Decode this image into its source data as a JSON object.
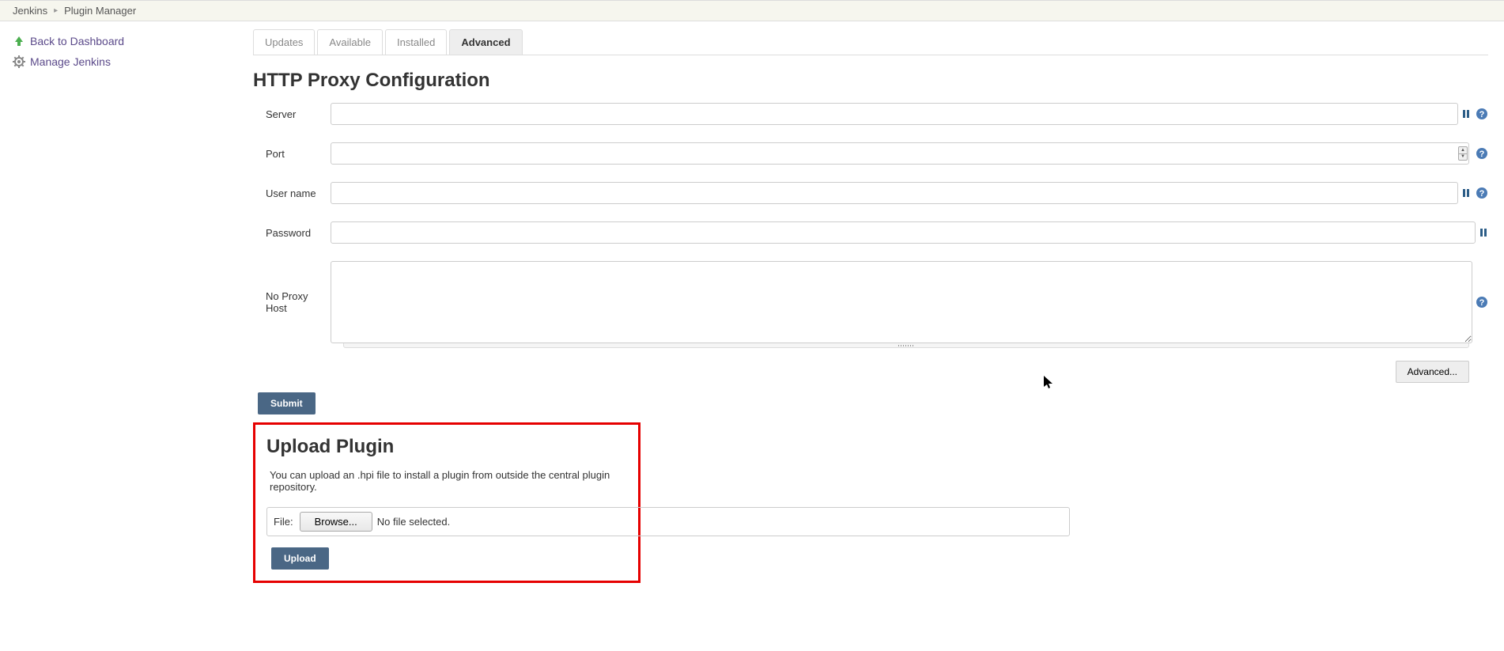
{
  "breadcrumb": {
    "root": "Jenkins",
    "current": "Plugin Manager"
  },
  "sidebar": {
    "back": "Back to Dashboard",
    "manage": "Manage Jenkins"
  },
  "tabs": {
    "updates": "Updates",
    "available": "Available",
    "installed": "Installed",
    "advanced": "Advanced"
  },
  "proxy": {
    "title": "HTTP Proxy Configuration",
    "server_label": "Server",
    "server_value": "",
    "port_label": "Port",
    "port_value": "",
    "user_label": "User name",
    "user_value": "",
    "password_label": "Password",
    "password_value": "",
    "noproxy_label": "No Proxy Host",
    "noproxy_value": "",
    "advanced_btn": "Advanced...",
    "submit_btn": "Submit"
  },
  "upload": {
    "title": "Upload Plugin",
    "desc": "You can upload an .hpi file to install a plugin from outside the central plugin repository.",
    "file_label": "File:",
    "browse_btn": "Browse...",
    "file_status": "No file selected.",
    "upload_btn": "Upload"
  }
}
